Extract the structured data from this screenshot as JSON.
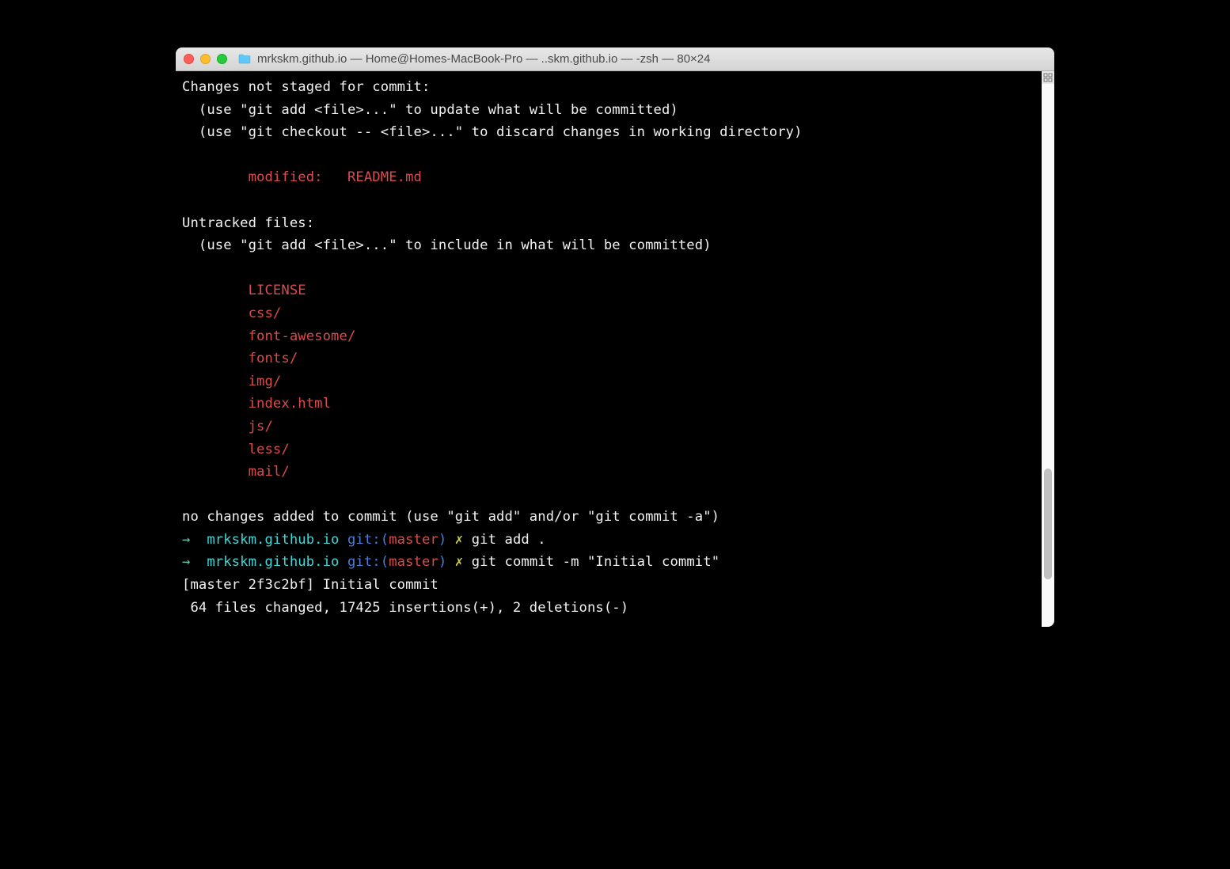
{
  "titlebar": {
    "title": "mrkskm.github.io — Home@Homes-MacBook-Pro — ..skm.github.io — -zsh — 80×24"
  },
  "terminal": {
    "lines": {
      "changes_header": "Changes not staged for commit:",
      "use_add": "  (use \"git add <file>...\" to update what will be committed)",
      "use_checkout": "  (use \"git checkout -- <file>...\" to discard changes in working directory)",
      "blank": "",
      "modified": "        modified:   README.md",
      "untracked_header": "Untracked files:",
      "use_add_include": "  (use \"git add <file>...\" to include in what will be committed)",
      "f_license": "        LICENSE",
      "f_css": "        css/",
      "f_fa": "        font-awesome/",
      "f_fonts": "        fonts/",
      "f_img": "        img/",
      "f_index": "        index.html",
      "f_js": "        js/",
      "f_less": "        less/",
      "f_mail": "        mail/",
      "no_changes": "no changes added to commit (use \"git add\" and/or \"git commit -a\")"
    },
    "prompt": {
      "arrow": "→  ",
      "dir": "mrkskm.github.io",
      "git_open": " git:(",
      "branch": "master",
      "git_close": ") ",
      "x": "✗ ",
      "cmd1": "git add .",
      "cmd2": "git commit -m \"Initial commit\""
    },
    "result": {
      "line1": "[master 2f3c2bf] Initial commit",
      "line2": " 64 files changed, 17425 insertions(+), 2 deletions(-)"
    }
  }
}
